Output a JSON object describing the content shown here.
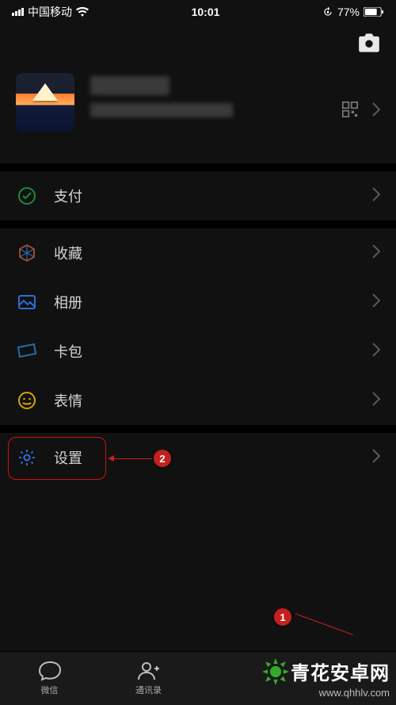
{
  "status": {
    "carrier": "中国移动",
    "time": "10:01",
    "battery": "77%"
  },
  "profile": {
    "name_redacted": true,
    "subtitle_redacted": true
  },
  "menu": {
    "pay": "支付",
    "favorites": "收藏",
    "album": "相册",
    "cards": "卡包",
    "sticker": "表情",
    "settings": "设置"
  },
  "tabs": {
    "chats": "微信",
    "contacts": "通讯录"
  },
  "annotations": {
    "step1": "1",
    "step2": "2"
  },
  "watermark": {
    "brand": "青花安卓网",
    "url": "www.qhhlv.com"
  }
}
